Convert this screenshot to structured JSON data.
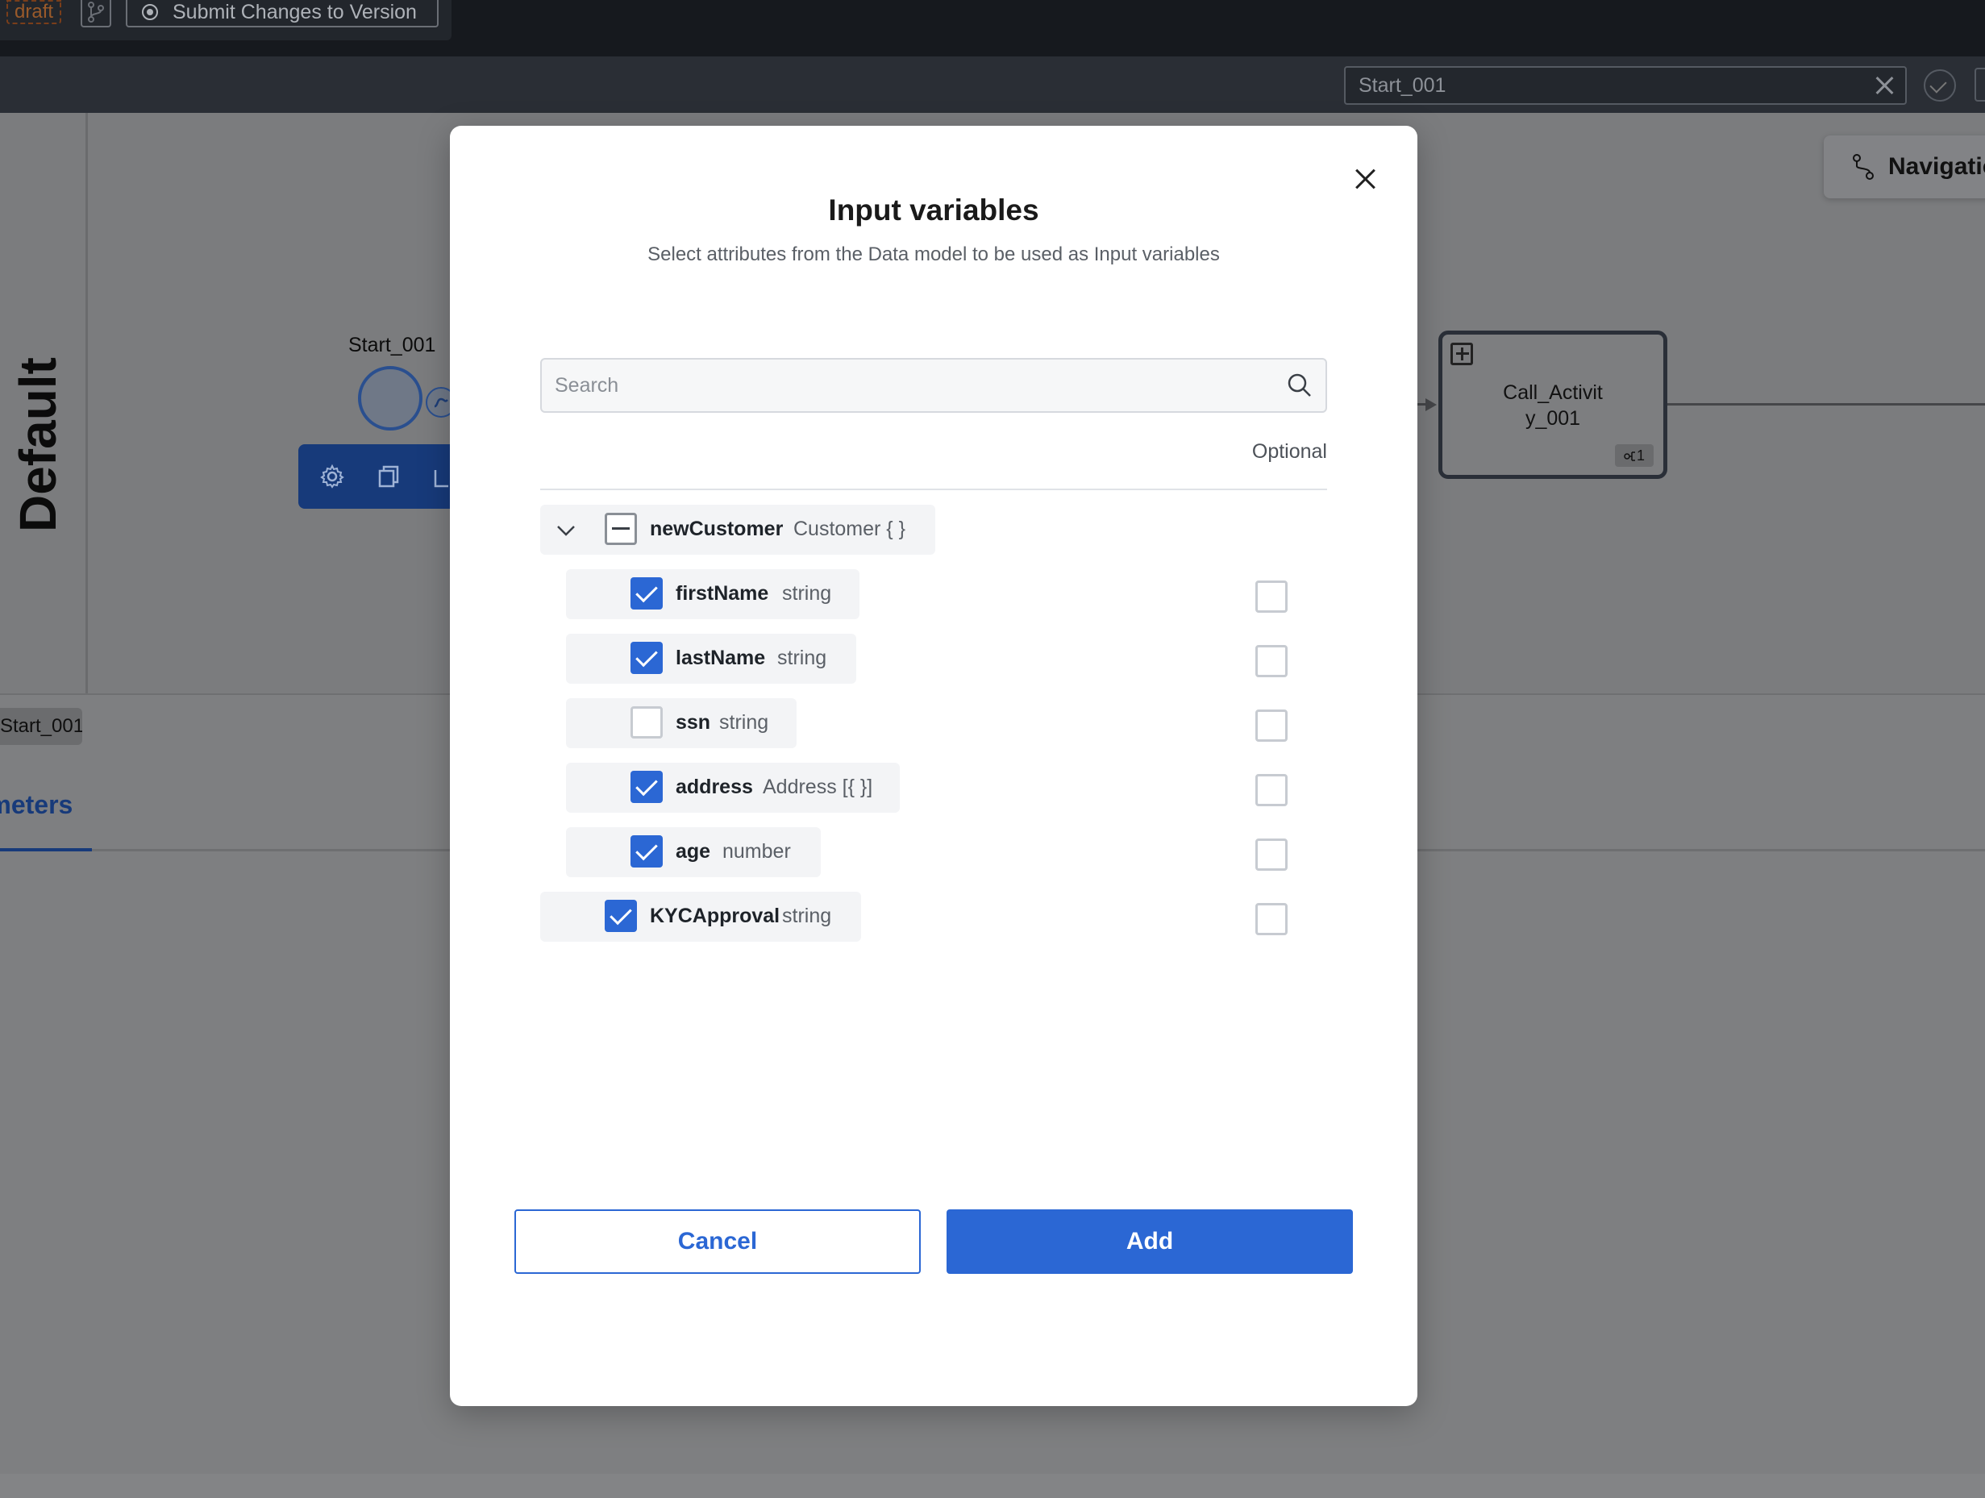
{
  "topbar": {
    "draft_label": "draft",
    "submit_label": "Submit Changes to Version"
  },
  "toolbar": {
    "node_search_value": "Start_001"
  },
  "canvas": {
    "lane_label": "Default",
    "start_event_label": "Start_001",
    "call_activity_label_line1": "Call_Activit",
    "call_activity_label_line2": "y_001",
    "call_activity_badge": "1",
    "navigation_label": "Navigation"
  },
  "properties": {
    "node_tag": "Start_001",
    "active_tab": "Parameters"
  },
  "modal": {
    "title": "Input variables",
    "subtitle": "Select attributes from the Data model to be used as Input variables",
    "search_placeholder": "Search",
    "optional_header": "Optional",
    "root": {
      "name": "newCustomer",
      "type": "Customer { }",
      "state": "partial",
      "expanded": true
    },
    "attributes": [
      {
        "name": "firstName",
        "type": "string",
        "selected": true,
        "optional": false
      },
      {
        "name": "lastName",
        "type": "string",
        "selected": true,
        "optional": false
      },
      {
        "name": "ssn",
        "type": "string",
        "selected": false,
        "optional": false
      },
      {
        "name": "address",
        "type": "Address [{ }]",
        "selected": true,
        "optional": false
      },
      {
        "name": "age",
        "type": "number",
        "selected": true,
        "optional": false
      }
    ],
    "extra": {
      "name": "KYCApproval",
      "type": "string",
      "selected": true,
      "optional": false
    },
    "cancel_label": "Cancel",
    "add_label": "Add"
  },
  "colors": {
    "primary": "#2b67d4",
    "overlay": "#7e7f81",
    "topbar": "#16191e"
  }
}
